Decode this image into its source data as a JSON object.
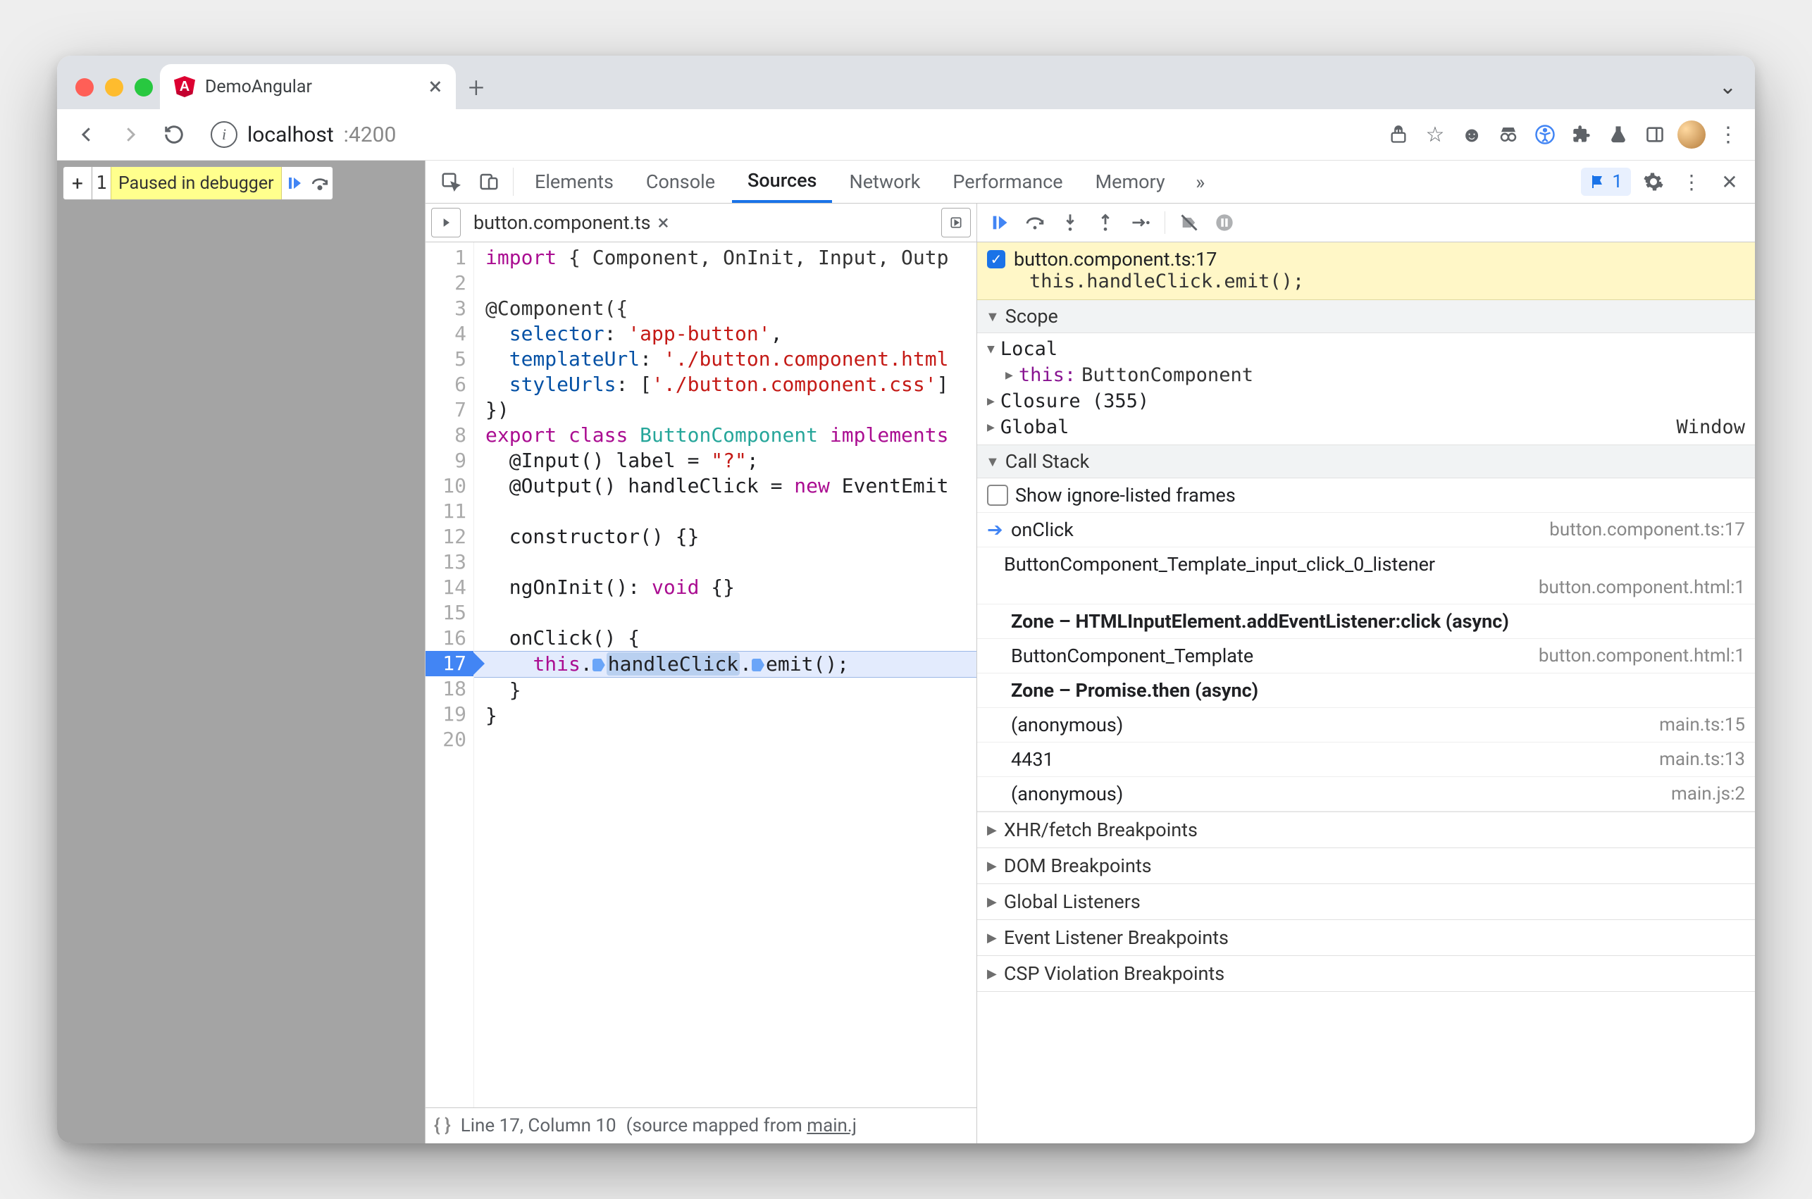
{
  "tab": {
    "title": "DemoAngular"
  },
  "url": {
    "host": "localhost",
    "port": ":4200"
  },
  "paused": {
    "label": "Paused in debugger"
  },
  "devtools_tabs": [
    "Elements",
    "Console",
    "Sources",
    "Network",
    "Performance",
    "Memory"
  ],
  "devtools_active": "Sources",
  "issues_count": "1",
  "file_tab": "button.component.ts",
  "code_lines": [
    {
      "n": 1,
      "html": "<span class='tok-kw'>import</span> <span class='tok-id'>{ Component, OnInit, Input, Outp</span>"
    },
    {
      "n": 2,
      "html": ""
    },
    {
      "n": 3,
      "html": "<span class='tok-id'>@Component({</span>"
    },
    {
      "n": 4,
      "html": "  <span class='tok-prop'>selector</span>: <span class='tok-str'>'app-button'</span>,"
    },
    {
      "n": 5,
      "html": "  <span class='tok-prop'>templateUrl</span>: <span class='tok-str'>'./button.component.html</span>"
    },
    {
      "n": 6,
      "html": "  <span class='tok-prop'>styleUrls</span>: [<span class='tok-str'>'./button.component.css'</span>]"
    },
    {
      "n": 7,
      "html": "})"
    },
    {
      "n": 8,
      "html": "<span class='tok-kw'>export</span> <span class='tok-kw'>class</span> <span class='tok-cls'>ButtonComponent</span> <span class='tok-kw'>implements</span>"
    },
    {
      "n": 9,
      "html": "  @Input() label = <span class='tok-str'>\"?\"</span>;"
    },
    {
      "n": 10,
      "html": "  @Output() handleClick = <span class='tok-kw'>new</span> EventEmit"
    },
    {
      "n": 11,
      "html": ""
    },
    {
      "n": 12,
      "html": "  constructor() {}"
    },
    {
      "n": 13,
      "html": ""
    },
    {
      "n": 14,
      "html": "  ngOnInit(): <span class='tok-kw'>void</span> {}"
    },
    {
      "n": 15,
      "html": ""
    },
    {
      "n": 16,
      "html": "  onClick() {"
    },
    {
      "n": 17,
      "hl": true,
      "html": "    <span class='tok-kw'>this</span>.<span class='dot'></span><span class='pill'>handleClick</span>.<span class='dot'></span>emit();"
    },
    {
      "n": 18,
      "html": "  }"
    },
    {
      "n": 19,
      "html": "}"
    },
    {
      "n": 20,
      "html": ""
    }
  ],
  "status": {
    "line": "Line 17, Column 10",
    "mapped_prefix": "(source mapped from ",
    "mapped_link": "main.j"
  },
  "breakpoint": {
    "file": "button.component.ts:17",
    "expr": "this.handleClick.emit();"
  },
  "scope": {
    "header": "Scope",
    "local": "Local",
    "this_key": "this:",
    "this_val": "ButtonComponent",
    "closure": "Closure (355)",
    "global": "Global",
    "window": "Window"
  },
  "callstack": {
    "header": "Call Stack",
    "show_ignored": "Show ignore-listed frames",
    "frames": [
      {
        "name": "onClick",
        "loc": "button.component.ts:17",
        "current": true
      },
      {
        "name": "ButtonComponent_Template_input_click_0_listener",
        "loc": "button.component.html:1",
        "wrap": true
      },
      {
        "name": "Zone – HTMLInputElement.addEventListener:click (async)",
        "bold": true
      },
      {
        "name": "ButtonComponent_Template",
        "loc": "button.component.html:1"
      },
      {
        "name": "Zone – Promise.then (async)",
        "bold": true
      },
      {
        "name": "(anonymous)",
        "loc": "main.ts:15"
      },
      {
        "name": "4431",
        "loc": "main.ts:13"
      },
      {
        "name": "(anonymous)",
        "loc": "main.js:2"
      }
    ]
  },
  "collapsibles": [
    "XHR/fetch Breakpoints",
    "DOM Breakpoints",
    "Global Listeners",
    "Event Listener Breakpoints",
    "CSP Violation Breakpoints"
  ]
}
